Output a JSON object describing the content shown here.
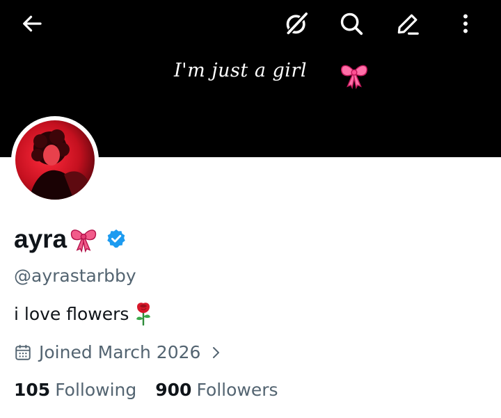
{
  "header": {
    "banner_text": "I'm just a girl",
    "back_icon": "arrow-left-icon",
    "grok_icon": "slashed-circle-icon",
    "search_icon": "search-icon",
    "edit_icon": "pencil-icon",
    "more_icon": "more-vertical-icon"
  },
  "profile": {
    "display_name": "ayra",
    "name_emoji": "ribbon-bow",
    "verified": true,
    "handle": "@ayrastarbby",
    "bio": "i love flowers",
    "bio_emoji": "rose",
    "joined": "Joined March 2026"
  },
  "stats": {
    "following_count": "105",
    "following_label": "Following",
    "followers_count": "900",
    "followers_label": "Followers"
  },
  "colors": {
    "banner": "#000000",
    "text_primary": "#0f1419",
    "text_secondary": "#536471",
    "verified": "#1d9bf0",
    "bow": "#f25c8b"
  }
}
